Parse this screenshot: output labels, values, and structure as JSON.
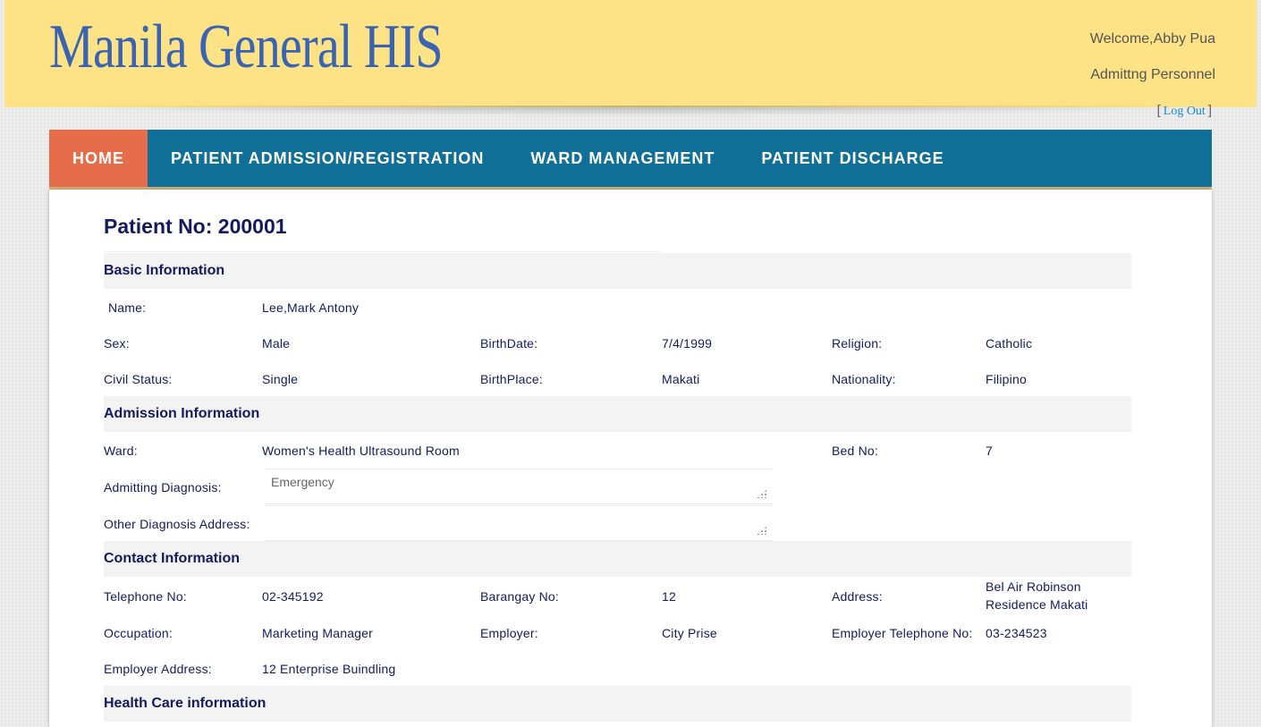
{
  "header": {
    "logo": "Manila General HIS",
    "welcome": "Welcome,Abby Pua",
    "role": "Admittng Personnel",
    "logout_open": "[",
    "logout_label": "Log Out",
    "logout_close": "]"
  },
  "nav": {
    "items": [
      {
        "label": "HOME",
        "active": true
      },
      {
        "label": "PATIENT ADMISSION/REGISTRATION",
        "active": false
      },
      {
        "label": "WARD MANAGEMENT",
        "active": false
      },
      {
        "label": "PATIENT DISCHARGE",
        "active": false
      }
    ]
  },
  "patient": {
    "title": "Patient No: 200001"
  },
  "basic": {
    "heading": "Basic Information",
    "name_label": "Name:",
    "name": "Lee,Mark Antony",
    "sex_label": "Sex:",
    "sex": "Male",
    "birthdate_label": "BirthDate:",
    "birthdate": "7/4/1999",
    "religion_label": "Religion:",
    "religion": "Catholic",
    "civil_label": "Civil Status:",
    "civil": "Single",
    "birthplace_label": "BirthPlace:",
    "birthplace": "Makati",
    "nationality_label": "Nationality:",
    "nationality": "Filipino"
  },
  "admission": {
    "heading": "Admission Information",
    "ward_label": "Ward:",
    "ward": "Women's Health Ultrasound Room",
    "bed_label": "Bed No:",
    "bed": "7",
    "diag_label": "Admitting Diagnosis:",
    "diag": "Emergency",
    "other_label": "Other Diagnosis Address:",
    "other": ""
  },
  "contact": {
    "heading": "Contact Information",
    "tel_label": "Telephone No:",
    "tel": "02-345192",
    "brgy_label": "Barangay No:",
    "brgy": "12",
    "address_label": "Address:",
    "address": "Bel Air Robinson Residence Makati",
    "occupation_label": "Occupation:",
    "occupation": "Marketing Manager",
    "employer_label": "Employer:",
    "employer": "City Prise",
    "emp_tel_label": "Employer Telephone No:",
    "emp_tel": "03-234523",
    "emp_addr_label": "Employer Address:",
    "emp_addr": "12 Enterprise Buindling"
  },
  "health": {
    "heading": "Health Care information"
  }
}
